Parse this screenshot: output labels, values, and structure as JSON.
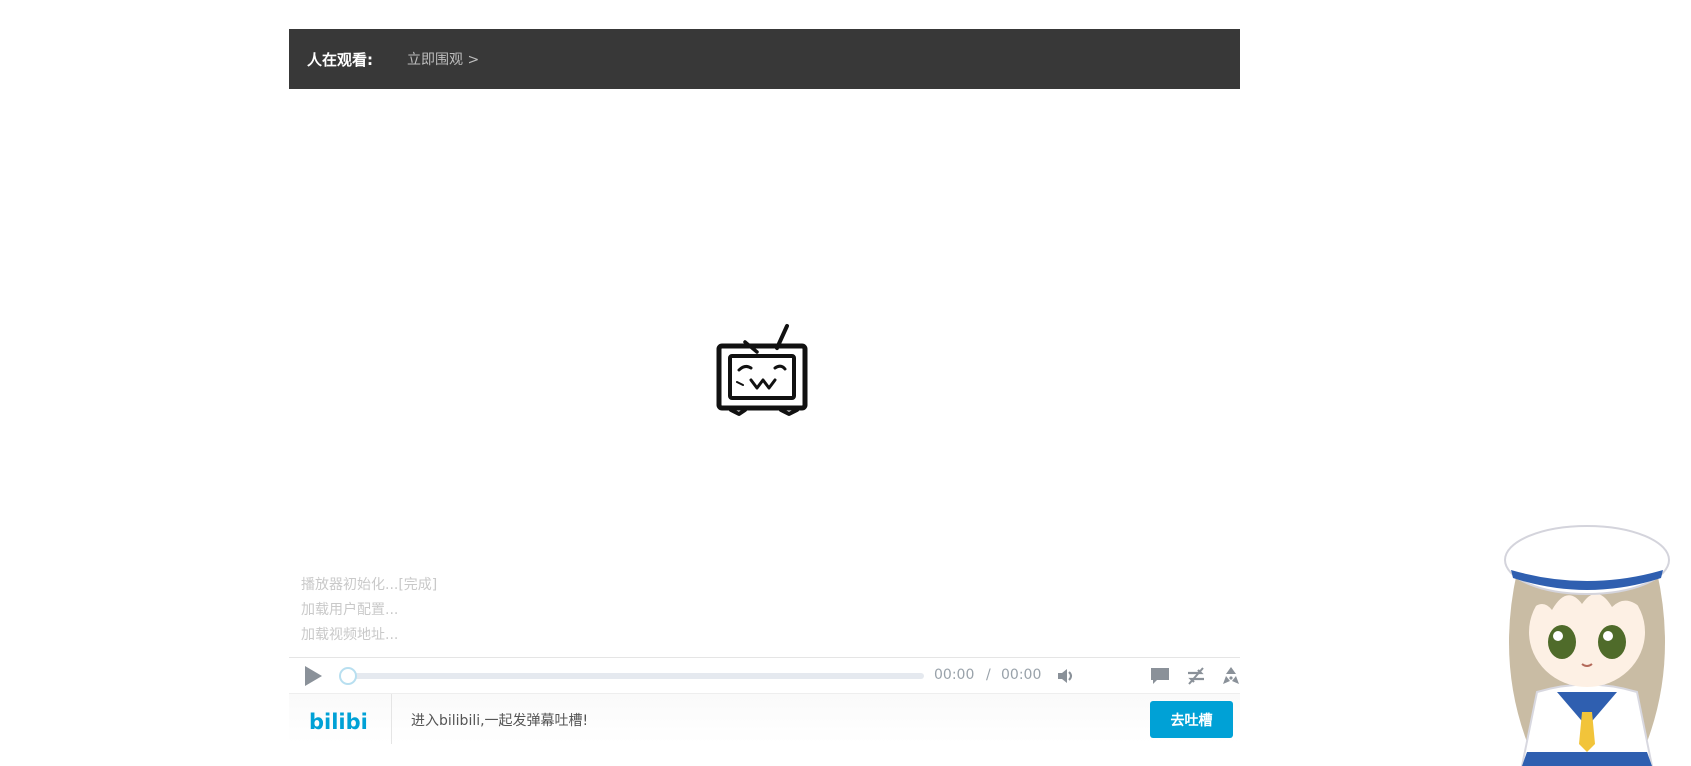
{
  "topbar": {
    "watching_label": "人在观看:",
    "watch_link": "立即围观 >"
  },
  "screen": {
    "logo_icon": "bilibili-tv-icon",
    "log_lines": [
      "播放器初始化...[完成]",
      "加载用户配置...",
      "加载视频地址..."
    ]
  },
  "controls": {
    "current_time": "00:00",
    "separator": "/",
    "total_time": "00:00",
    "progress": 0,
    "icons": [
      "play-icon",
      "volume-icon",
      "danmaku-icon",
      "danmaku-toggle-icon",
      "radiation-icon"
    ]
  },
  "bottombar": {
    "logo_text": "bilibili",
    "hint": "进入bilibili,一起发弹幕吐槽!",
    "send_label": "去吐槽"
  },
  "colors": {
    "accent": "#00a1d6",
    "topbar": "#383838",
    "log_text": "#c9c9c9"
  }
}
